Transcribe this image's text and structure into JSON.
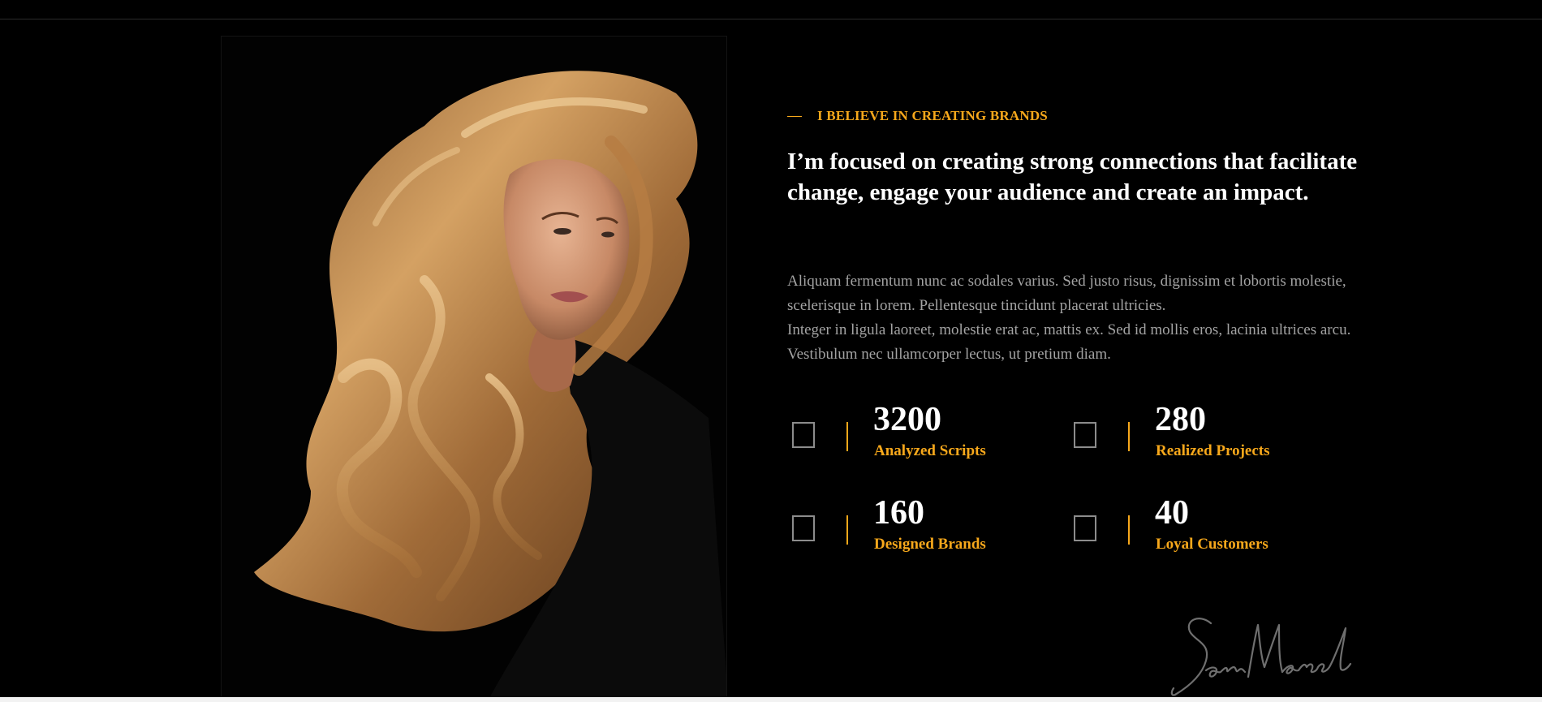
{
  "hero": {
    "eyebrow": "I BELIEVE IN CREATING BRANDS",
    "headline": "I’m focused on creating strong connections that facilitate change, engage your audience and create an impact.",
    "paragraphs": [
      "Aliquam fermentum nunc ac sodales varius. Sed justo risus, dignissim et lobortis molestie, scelerisque in lorem. Pellentesque tincidunt placerat ultricies.",
      "Integer in ligula laoreet, molestie erat ac, mattis ex. Sed id mollis eros, lacinia ultrices arcu. Vestibulum nec ullamcorper lectus, ut pretium diam."
    ]
  },
  "stats": [
    {
      "value": "3200",
      "label": "Analyzed Scripts",
      "icon": "script-icon"
    },
    {
      "value": "280",
      "label": "Realized Projects",
      "icon": "project-icon"
    },
    {
      "value": "160",
      "label": "Designed Brands",
      "icon": "brand-icon"
    },
    {
      "value": "40",
      "label": "Loyal Customers",
      "icon": "customer-icon"
    }
  ],
  "signature": "Sam Marcel",
  "colors": {
    "background": "#000000",
    "accent": "#f7a81b",
    "heading": "#ffffff",
    "body_text": "#a3a3a3"
  }
}
